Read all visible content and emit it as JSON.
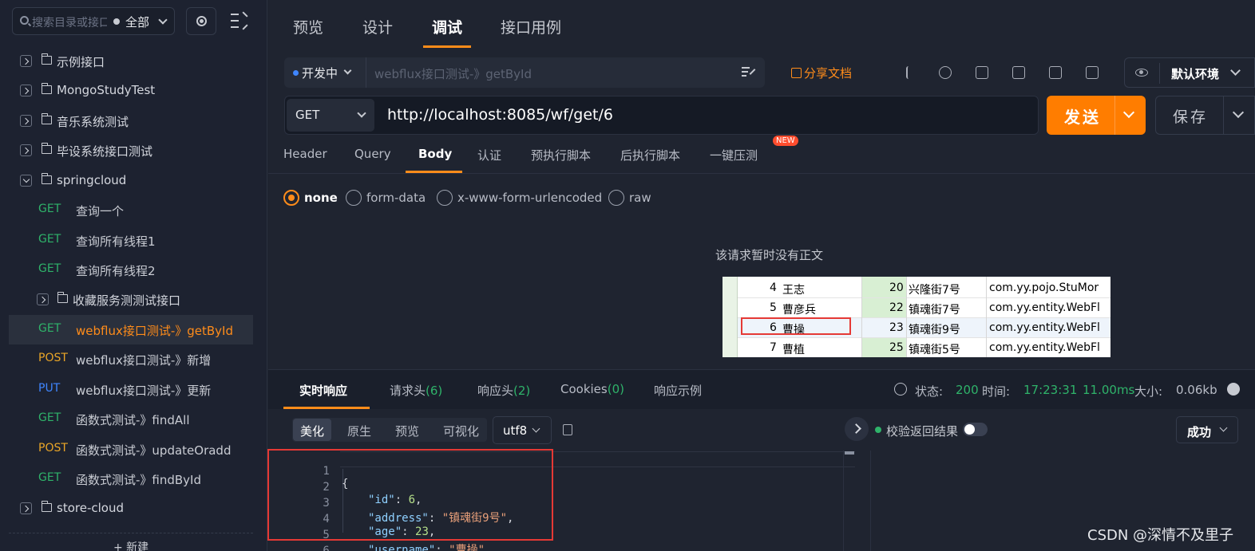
{
  "sidebar": {
    "search_placeholder": "搜索目录或接口",
    "scope": "全部",
    "tree": [
      {
        "label": "示例接口"
      },
      {
        "label": "MongoStudyTest"
      },
      {
        "label": "音乐系统测试"
      },
      {
        "label": "毕设系统接口测试"
      },
      {
        "label": "springcloud"
      }
    ],
    "apis": [
      {
        "method": "GET",
        "label": "查询一个"
      },
      {
        "method": "GET",
        "label": "查询所有线程1"
      },
      {
        "method": "GET",
        "label": "查询所有线程2"
      }
    ],
    "subfolder": "收藏服务测测试接口",
    "apis2": [
      {
        "method": "GET",
        "label": "webflux接口测试-》getById"
      },
      {
        "method": "POST",
        "label": "webflux接口测试-》新增"
      },
      {
        "method": "PUT",
        "label": "webflux接口测试-》更新"
      },
      {
        "method": "GET",
        "label": "函数式测试-》findAll"
      },
      {
        "method": "POST",
        "label": "函数式测试-》updateOradd"
      },
      {
        "method": "GET",
        "label": "函数式测试-》findById"
      }
    ],
    "last_folder": "store-cloud",
    "new_button": "+ 新建"
  },
  "top_tabs": [
    "预览",
    "设计",
    "调试",
    "接口用例"
  ],
  "status": {
    "value": "开发中",
    "api_name": "webflux接口测试-》getById",
    "share": "分享文档"
  },
  "environment": "默认环境",
  "request": {
    "method": "GET",
    "url": "http://localhost:8085/wf/get/6",
    "send": "发送",
    "save": "保存"
  },
  "req_tabs": [
    "Header",
    "Query",
    "Body",
    "认证",
    "预执行脚本",
    "后执行脚本",
    "一键压测"
  ],
  "new_badge": "NEW",
  "body_types": [
    "none",
    "form-data",
    "x-www-form-urlencoded",
    "raw"
  ],
  "empty_body": "该请求暂时没有正文",
  "sheet_rows": [
    {
      "id": "4",
      "name": "王志",
      "age": "20",
      "address": "兴隆街7号",
      "cls": "com.yy.pojo.StuMor"
    },
    {
      "id": "5",
      "name": "曹彦兵",
      "age": "22",
      "address": "镇魂街7号",
      "cls": "com.yy.entity.WebFl"
    },
    {
      "id": "6",
      "name": "曹操",
      "age": "23",
      "address": "镇魂街9号",
      "cls": "com.yy.entity.WebFl"
    },
    {
      "id": "7",
      "name": "曹植",
      "age": "25",
      "address": "镇魂街5号",
      "cls": "com.yy.entity.WebFl"
    }
  ],
  "resp_tabs": {
    "realtime": "实时响应",
    "req_headers": "请求头",
    "req_headers_count": "(6)",
    "resp_headers": "响应头",
    "resp_headers_count": "(2)",
    "cookies": "Cookies",
    "cookies_count": "(0)",
    "example": "响应示例"
  },
  "resp_meta": {
    "status_label": "状态:",
    "status": "200",
    "time_label": "时间:",
    "time": "17:23:31",
    "duration": "11.00ms",
    "size_label": "大小:",
    "size": "0.06kb"
  },
  "format_buttons": [
    "美化",
    "原生",
    "预览",
    "可视化"
  ],
  "encoding": "utf8",
  "code_lines": [
    {
      "n": "1",
      "t": "{"
    },
    {
      "n": "2",
      "k": "\"id\"",
      "v": "6",
      "vt": "n",
      "end": ","
    },
    {
      "n": "3",
      "k": "\"address\"",
      "v": "\"镇魂街9号\"",
      "vt": "s",
      "end": ","
    },
    {
      "n": "4",
      "k": "\"age\"",
      "v": "23",
      "vt": "n",
      "end": ","
    },
    {
      "n": "5",
      "k": "\"username\"",
      "v": "\"曹操\"",
      "vt": "s",
      "end": ""
    },
    {
      "n": "6",
      "t": "}"
    }
  ],
  "validate_label": "校验返回结果",
  "result": "成功",
  "watermark": "CSDN @深情不及里子",
  "colors": {
    "accent": "#ff8c1a",
    "send": "#ff7d00",
    "get": "#2fb36a",
    "post": "#e9a527",
    "put": "#3f86ff"
  }
}
